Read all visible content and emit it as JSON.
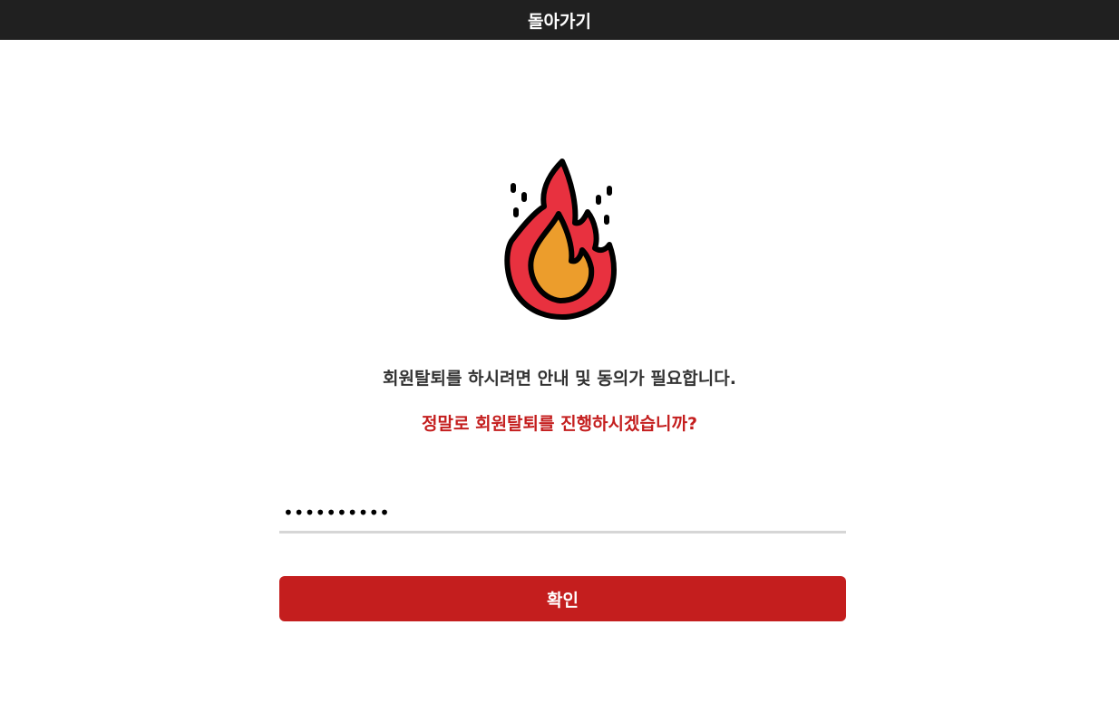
{
  "header": {
    "back_label": "돌아가기"
  },
  "icon": {
    "name": "fire-icon"
  },
  "messages": {
    "notice": "회원탈퇴를 하시려면 안내 및 동의가 필요합니다.",
    "confirm_question": "정말로 회원탈퇴를 진행하시겠습니까?"
  },
  "password": {
    "value": "••••••••••"
  },
  "button": {
    "confirm_label": "확인"
  },
  "colors": {
    "header_bg": "#202020",
    "accent_red": "#c41e1e",
    "flame_red": "#e8313f",
    "flame_orange": "#ec9d2c"
  }
}
